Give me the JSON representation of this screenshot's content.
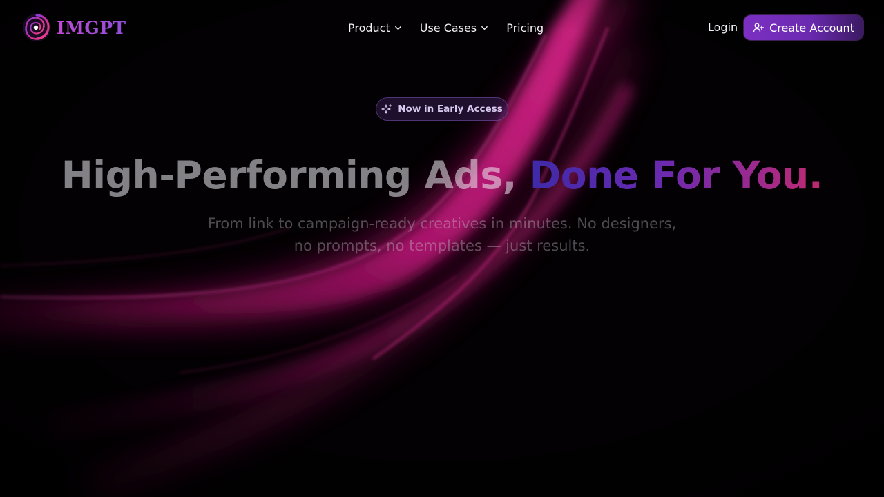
{
  "nav": {
    "brand": "IMGPT",
    "links": [
      {
        "label": "Product",
        "has_dropdown": true
      },
      {
        "label": "Use Cases",
        "has_dropdown": true
      },
      {
        "label": "Pricing",
        "has_dropdown": false
      }
    ],
    "login_label": "Login",
    "cta_label": "Create Account",
    "cta_icon": "user-plus-icon"
  },
  "hero": {
    "badge_label": "Now in Early Access",
    "badge_icon": "sparkles-icon",
    "headline_part1": "High-Performing Ads,",
    "headline_part2": "Done For You.",
    "subtitle_line1": "From link to campaign-ready creatives in minutes. No designers,",
    "subtitle_line2": "no prompts, no templates — just results."
  },
  "colors": {
    "background": "#030103",
    "accent_purple": "#7c2fc2",
    "accent_pink": "#e0208a",
    "brand_text": "#b54bd6"
  }
}
